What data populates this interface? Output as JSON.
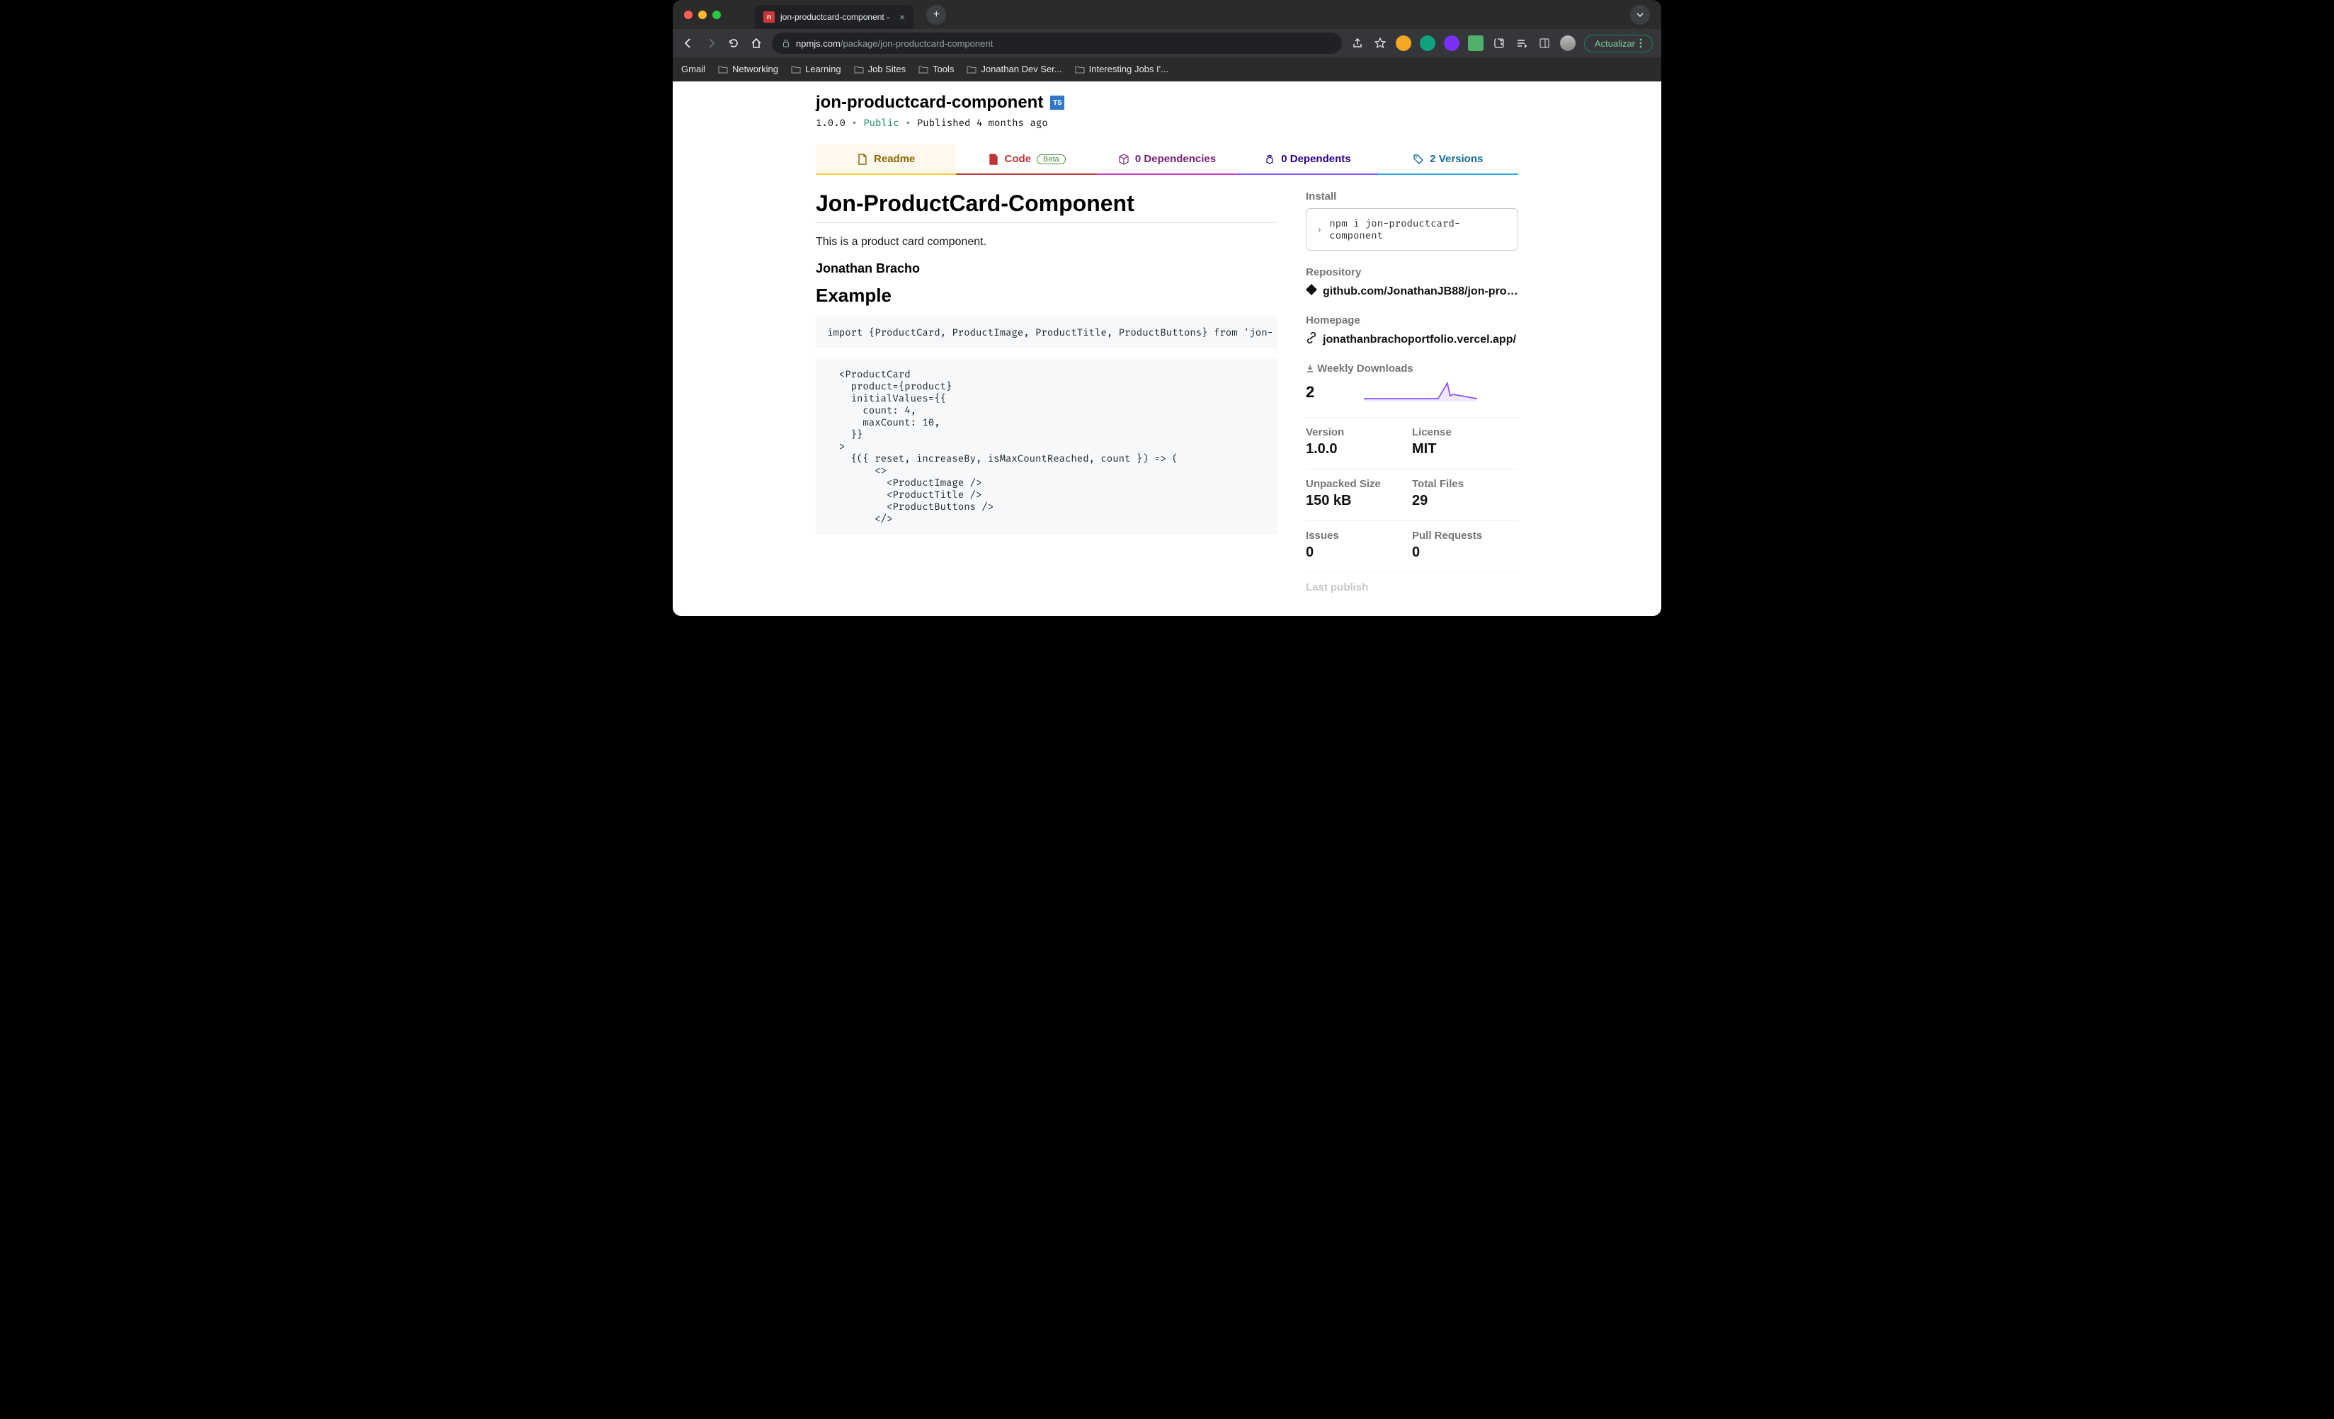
{
  "browser": {
    "tab_title": "jon-productcard-component -",
    "url_display": "npmjs.com/package/jon-productcard-component",
    "update_button": "Actualizar",
    "bookmarks": [
      "Gmail",
      "Networking",
      "Learning",
      "Job Sites",
      "Tools",
      "Jonathan Dev Ser...",
      "Interesting Jobs I'..."
    ]
  },
  "package": {
    "name": "jon-productcard-component",
    "ts_badge": "TS",
    "version_line": "1.0.0",
    "visibility": "Public",
    "published": "Published 4 months ago"
  },
  "tabs": {
    "readme": "Readme",
    "code": "Code",
    "code_badge": "Beta",
    "deps": "0 Dependencies",
    "dependents": "0 Dependents",
    "versions": "2 Versions"
  },
  "readme": {
    "title": "Jon-ProductCard-Component",
    "intro": "This is a product card component.",
    "author": "Jonathan Bracho",
    "example_heading": "Example",
    "code1": "import {ProductCard, ProductImage, ProductTitle, ProductButtons} from 'jon-",
    "code2": "  <ProductCard\n    product={product}\n    initialValues={{\n      count: 4,\n      maxCount: 10,\n    }}\n  >\n    {({ reset, increaseBy, isMaxCountReached, count }) => (\n        <>\n          <ProductImage />\n          <ProductTitle />\n          <ProductButtons />\n        </>"
  },
  "sidebar": {
    "install_label": "Install",
    "install_cmd": "npm i jon-productcard-component",
    "repo_label": "Repository",
    "repo_value": "github.com/JonathanJB88/jon-product...",
    "homepage_label": "Homepage",
    "homepage_value": "jonathanbrachoportfolio.vercel.app/",
    "downloads_label": "Weekly Downloads",
    "downloads_value": "2",
    "meta": {
      "version_label": "Version",
      "version_value": "1.0.0",
      "license_label": "License",
      "license_value": "MIT",
      "size_label": "Unpacked Size",
      "size_value": "150 kB",
      "files_label": "Total Files",
      "files_value": "29",
      "issues_label": "Issues",
      "issues_value": "0",
      "pr_label": "Pull Requests",
      "pr_value": "0"
    },
    "last_publish": "Last publish"
  }
}
